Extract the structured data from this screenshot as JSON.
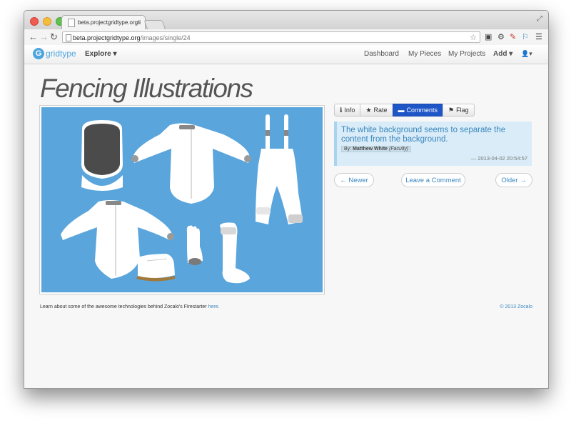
{
  "browser": {
    "tab_title": "beta.projectgridtype.org/i",
    "tab_close": "×",
    "url_host": "beta.projectgridtype.org",
    "url_path": "/images/single/24"
  },
  "nav": {
    "logo_letter": "G",
    "logo_text": "gridtype",
    "explore": "Explore ▾",
    "links": [
      "Dashboard",
      "My Pieces",
      "My Projects"
    ],
    "add": "Add ▾",
    "user": "👤▾"
  },
  "page": {
    "title": "Fencing Illustrations",
    "image_bg": "#5aa5dc"
  },
  "panel": {
    "tabs": [
      {
        "icon": "ℹ",
        "label": "Info"
      },
      {
        "icon": "★",
        "label": "Rate"
      },
      {
        "icon": "▬",
        "label": "Comments"
      },
      {
        "icon": "⚑",
        "label": "Flag"
      }
    ],
    "active_tab": "Comments",
    "comment": {
      "text": "The white background seems to separate the content from the background.",
      "by_label": "By:",
      "author": "Matthew White",
      "role": "(Faculty)",
      "timestamp": "— 2013-04-02 20:54:57"
    }
  },
  "pager": {
    "newer": "← Newer",
    "leave": "Leave a Comment",
    "older": "Older →"
  },
  "footer": {
    "text": "Learn about some of the awesome technologies behind Zocalo's Firestarter ",
    "link": "here",
    "end": ".",
    "copyright": "© 2013 Zocalo"
  }
}
